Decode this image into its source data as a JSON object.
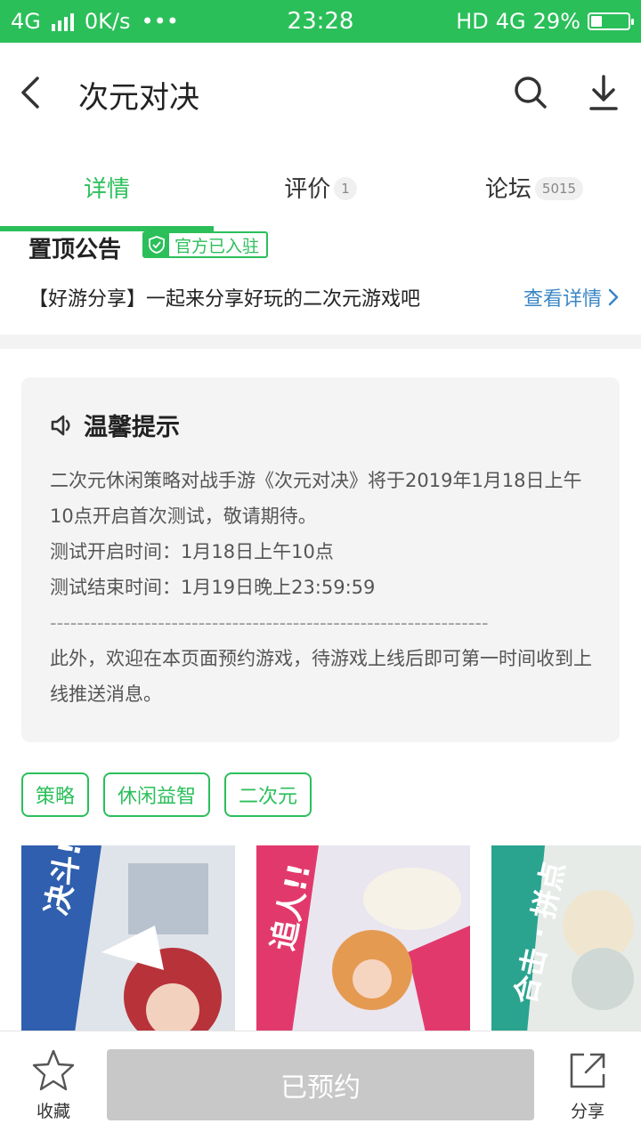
{
  "status_bar": {
    "network": "4G",
    "speed": "0K/s",
    "dots": "•••",
    "time": "23:28",
    "hd": "HD",
    "net2": "4G",
    "battery": "29%",
    "battery_level": 0.29
  },
  "header": {
    "title": "次元对决",
    "back_icon": "back-arrow-icon",
    "search_icon": "search-icon",
    "download_icon": "download-icon"
  },
  "tabs": [
    {
      "label": "详情",
      "count": ""
    },
    {
      "label": "评价",
      "count": "1"
    },
    {
      "label": "论坛",
      "count": "5015"
    }
  ],
  "notice": {
    "title": "置顶公告",
    "badge": "官方已入驻",
    "text": "【好游分享】一起来分享好玩的二次元游戏吧",
    "link": "查看详情"
  },
  "tips": {
    "title": "温馨提示",
    "lines": [
      "二次元休闲策略对战手游《次元对决》将于2019年1月18日上午10点开启首次测试，敬请期待。",
      "测试开启时间：1月18日上午10点",
      "测试结束时间：1月19日晚上23:59:59",
      "-----------------------------------------------------------------",
      "此外，欢迎在本页面预约游戏，待游戏上线后即可第一时间收到上线推送消息。"
    ]
  },
  "tags": [
    "策略",
    "休闲益智",
    "二次元"
  ],
  "screenshots": [
    "决斗!!",
    "追人!!",
    "合击 · 拼点"
  ],
  "bottom": {
    "fav_label": "收藏",
    "reserve_label": "已预约",
    "share_label": "分享"
  },
  "colors": {
    "accent": "#2bbf5a",
    "link": "#3a86c6",
    "disabled": "#c8c8c8"
  }
}
